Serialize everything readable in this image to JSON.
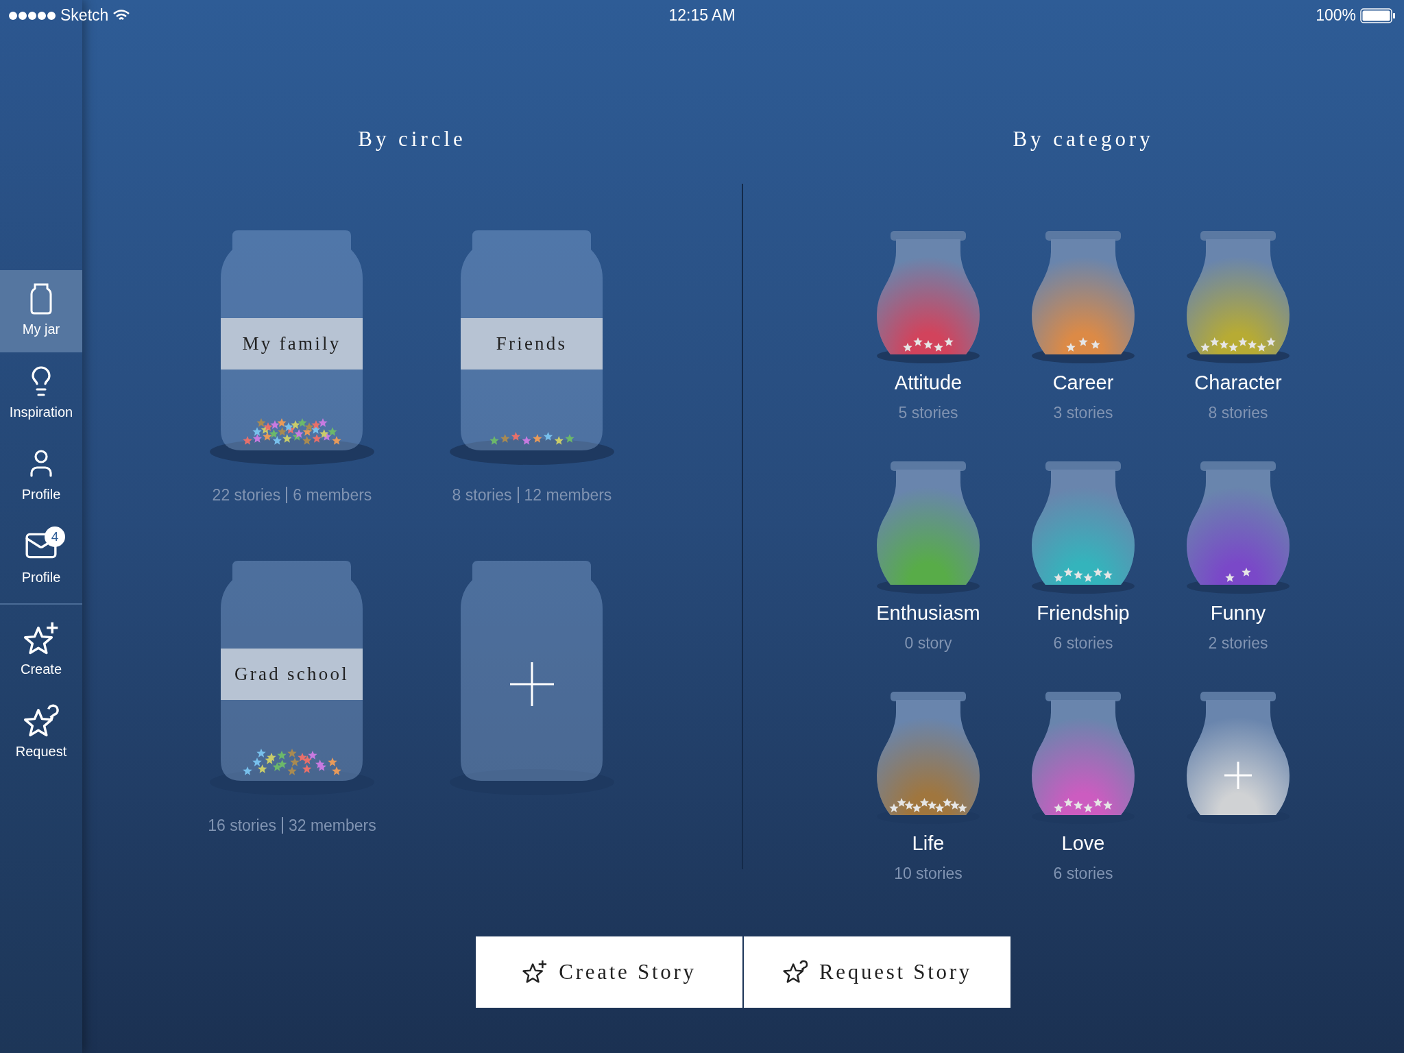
{
  "status_bar": {
    "carrier": "Sketch",
    "time": "12:15 AM",
    "battery": "100%"
  },
  "sidebar": {
    "items": [
      {
        "kind": "jar",
        "label": "My jar",
        "selected": true
      },
      {
        "kind": "bulb",
        "label": "Inspiration",
        "selected": false
      },
      {
        "kind": "person",
        "label": "Profile",
        "selected": false
      },
      {
        "kind": "mail",
        "label": "Profile",
        "selected": false,
        "badge": "4"
      }
    ],
    "actions": [
      {
        "kind": "create",
        "label": "Create"
      },
      {
        "kind": "request",
        "label": "Request"
      }
    ]
  },
  "circles": {
    "title": "By circle",
    "jars": [
      {
        "kind": "jar",
        "name": "My family",
        "stories": "22 stories",
        "members": "6 members"
      },
      {
        "kind": "jar",
        "name": "Friends",
        "stories": "8 stories",
        "members": "12 members"
      },
      {
        "kind": "jar",
        "name": "Grad school",
        "stories": "16 stories",
        "members": "32 members"
      },
      {
        "kind": "add"
      }
    ]
  },
  "categories": {
    "title": "By category",
    "jars": [
      {
        "kind": "jar",
        "name": "Attitude",
        "count": "5 stories",
        "color": "#d2435c"
      },
      {
        "kind": "jar",
        "name": "Career",
        "count": "3 stories",
        "color": "#dc8a46"
      },
      {
        "kind": "jar",
        "name": "Character",
        "count": "8 stories",
        "color": "#b7ab34"
      },
      {
        "kind": "jar",
        "name": "Enthusiasm",
        "count": "0 story",
        "color": "#58ac48"
      },
      {
        "kind": "jar",
        "name": "Friendship",
        "count": "6 stories",
        "color": "#34b4bc"
      },
      {
        "kind": "jar",
        "name": "Funny",
        "count": "2 stories",
        "color": "#7a48c8"
      },
      {
        "kind": "jar",
        "name": "Life",
        "count": "10 stories",
        "color": "#a0763e"
      },
      {
        "kind": "jar",
        "name": "Love",
        "count": "6 stories",
        "color": "#cc5cc0"
      },
      {
        "kind": "add"
      }
    ]
  },
  "buttons": [
    {
      "kind": "create",
      "label": "Create Story"
    },
    {
      "kind": "request",
      "label": "Request Story"
    }
  ]
}
